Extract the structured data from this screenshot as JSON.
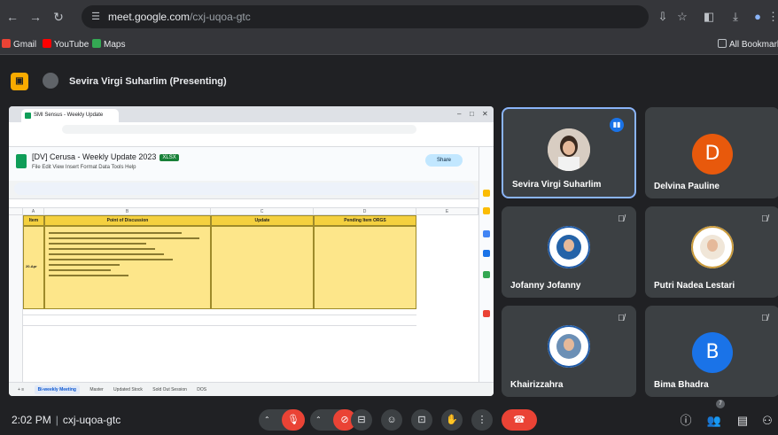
{
  "browser": {
    "url_host": "meet.google.com",
    "url_path": "/cxj-uqoa-gtc",
    "bookmarks": [
      "Gmail",
      "YouTube",
      "Maps"
    ],
    "all_bookmarks": "All Bookmarks"
  },
  "presenter": {
    "label": "Sevira Virgi Suharlim (Presenting)"
  },
  "shared_screen": {
    "tab_title": "SMI Sensus - Weekly Update",
    "doc_title": "[DV] Cerusa - Weekly Update 2023",
    "doc_badge": "XLSX",
    "menu": "File  Edit  View  Insert  Format  Data  Tools  Help",
    "share_label": "Share",
    "col_headers": [
      "A",
      "B",
      "C",
      "D",
      "E"
    ],
    "table_headers": [
      "Item",
      "Point of Discussion",
      "Update",
      "Pending Item ORGS"
    ],
    "row_label": "20-Apr",
    "sheet_tabs": [
      "Bi-weekly Meeting",
      "Master",
      "Updated Stock",
      "Sold Out Session",
      "DOS"
    ],
    "active_sheet": "Bi-weekly Meeting"
  },
  "participants": [
    {
      "name": "Sevira Virgi Suharlim",
      "type": "photo",
      "speaking": true
    },
    {
      "name": "Delvina Pauline",
      "type": "letter",
      "letter": "D",
      "color": "#e8590c"
    },
    {
      "name": "Jofanny Jofanny",
      "type": "logo",
      "muted": true
    },
    {
      "name": "Putri Nadea Lestari",
      "type": "photo2",
      "muted": true
    },
    {
      "name": "Khairizzahra",
      "type": "logo2",
      "muted": true
    },
    {
      "name": "Bima Bhadra",
      "type": "letter",
      "letter": "B",
      "color": "#1a73e8",
      "muted": true
    }
  ],
  "meeting": {
    "time": "2:02 PM",
    "code": "cxj-uqoa-gtc",
    "people_count": "7"
  },
  "colors": {
    "accent_blue": "#8ab4f8",
    "end_call_red": "#ea4335",
    "sheet_yellow": "#f4d03f"
  }
}
